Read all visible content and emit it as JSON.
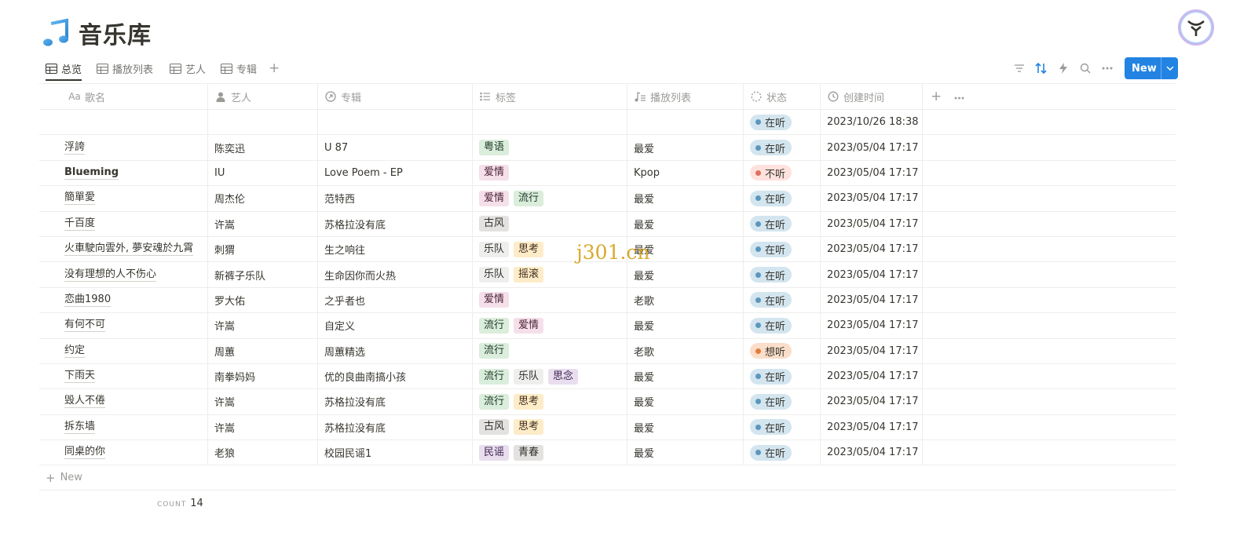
{
  "page": {
    "title": "音乐库",
    "title_icon": "music-note-icon"
  },
  "views": {
    "tabs": [
      {
        "label": "总览",
        "icon": "table-icon",
        "active": true
      },
      {
        "label": "播放列表",
        "icon": "table-icon",
        "active": false
      },
      {
        "label": "艺人",
        "icon": "table-icon",
        "active": false
      },
      {
        "label": "专辑",
        "icon": "table-icon",
        "active": false
      }
    ],
    "add_view": "+"
  },
  "toolbar": {
    "new_label": "New"
  },
  "columns": [
    {
      "label": "歌名",
      "icon": "text-icon",
      "icon_text": "Aa"
    },
    {
      "label": "艺人",
      "icon": "person-icon"
    },
    {
      "label": "专辑",
      "icon": "relation-icon"
    },
    {
      "label": "标签",
      "icon": "multi-select-icon"
    },
    {
      "label": "播放列表",
      "icon": "playlist-icon"
    },
    {
      "label": "状态",
      "icon": "status-icon"
    },
    {
      "label": "创建时间",
      "icon": "clock-icon"
    }
  ],
  "tag_colors": {
    "粤语": {
      "bg": "#dbeddb",
      "fg": "#1c3829"
    },
    "爱情": {
      "bg": "#f5e0e9",
      "fg": "#4c2337"
    },
    "流行": {
      "bg": "#dbeddb",
      "fg": "#1c3829"
    },
    "古风": {
      "bg": "#e3e2e0",
      "fg": "#32302c"
    },
    "乐队": {
      "bg": "#eeeeec",
      "fg": "#32302c"
    },
    "思考": {
      "bg": "#fdecc8",
      "fg": "#402c1b"
    },
    "摇滚": {
      "bg": "#fdecc8",
      "fg": "#402c1b"
    },
    "思念": {
      "bg": "#e8deee",
      "fg": "#412454"
    },
    "民谣": {
      "bg": "#e8deee",
      "fg": "#412454"
    },
    "青春": {
      "bg": "#e3e2e0",
      "fg": "#32302c"
    }
  },
  "status_colors": {
    "在听": {
      "bg": "#d3e5ef",
      "dot": "#5b97bd"
    },
    "不听": {
      "bg": "#ffe2dd",
      "dot": "#e16f64"
    },
    "想听": {
      "bg": "#fadec9",
      "dot": "#e07f3a"
    }
  },
  "rows": [
    {
      "song": "",
      "artist": "",
      "album": "",
      "tags": [],
      "playlist": "",
      "status": "在听",
      "created": "2023/10/26 18:38"
    },
    {
      "song": "浮誇",
      "artist": "陈奕迅",
      "album": "U 87",
      "tags": [
        "粤语"
      ],
      "playlist": "最爱",
      "status": "在听",
      "created": "2023/05/04 17:17"
    },
    {
      "song": "Blueming",
      "artist": "IU",
      "album": "Love Poem - EP",
      "tags": [
        "爱情"
      ],
      "playlist": "Kpop",
      "status": "不听",
      "created": "2023/05/04 17:17",
      "bold": true
    },
    {
      "song": "簡單愛",
      "artist": "周杰伦",
      "album": "范特西",
      "tags": [
        "爱情",
        "流行"
      ],
      "playlist": "最爱",
      "status": "在听",
      "created": "2023/05/04 17:17"
    },
    {
      "song": "千百度",
      "artist": "许嵩",
      "album": "苏格拉没有底",
      "tags": [
        "古风"
      ],
      "playlist": "最爱",
      "status": "在听",
      "created": "2023/05/04 17:17"
    },
    {
      "song": "火車駛向雲外, 夢安魂於九霄",
      "artist": "刺猬",
      "album": "生之响往",
      "tags": [
        "乐队",
        "思考"
      ],
      "playlist": "最爱",
      "status": "在听",
      "created": "2023/05/04 17:17"
    },
    {
      "song": "没有理想的人不伤心",
      "artist": "新裤子乐队",
      "album": "生命因你而火热",
      "tags": [
        "乐队",
        "摇滚"
      ],
      "playlist": "最爱",
      "status": "在听",
      "created": "2023/05/04 17:17"
    },
    {
      "song": "恋曲1980",
      "artist": "罗大佑",
      "album": "之乎者也",
      "tags": [
        "爱情"
      ],
      "playlist": "老歌",
      "status": "在听",
      "created": "2023/05/04 17:17"
    },
    {
      "song": "有何不可",
      "artist": "许嵩",
      "album": "自定义",
      "tags": [
        "流行",
        "爱情"
      ],
      "playlist": "最爱",
      "status": "在听",
      "created": "2023/05/04 17:17"
    },
    {
      "song": "约定",
      "artist": "周蕙",
      "album": "周蕙精选",
      "tags": [
        "流行"
      ],
      "playlist": "老歌",
      "status": "想听",
      "created": "2023/05/04 17:17"
    },
    {
      "song": "下雨天",
      "artist": "南拳妈妈",
      "album": "优的良曲南搞小孩",
      "tags": [
        "流行",
        "乐队",
        "思念"
      ],
      "playlist": "最爱",
      "status": "在听",
      "created": "2023/05/04 17:17"
    },
    {
      "song": "毁人不倦",
      "artist": "许嵩",
      "album": "苏格拉没有底",
      "tags": [
        "流行",
        "思考"
      ],
      "playlist": "最爱",
      "status": "在听",
      "created": "2023/05/04 17:17"
    },
    {
      "song": "拆东墙",
      "artist": "许嵩",
      "album": "苏格拉没有底",
      "tags": [
        "古风",
        "思考"
      ],
      "playlist": "最爱",
      "status": "在听",
      "created": "2023/05/04 17:17"
    },
    {
      "song": "同桌的你",
      "artist": "老狼",
      "album": "校园民谣1",
      "tags": [
        "民谣",
        "青春"
      ],
      "playlist": "最爱",
      "status": "在听",
      "created": "2023/05/04 17:17"
    }
  ],
  "footer": {
    "new_row_label": "New",
    "count_label": "COUNT",
    "count_value": "14"
  },
  "watermark": "j301.cn"
}
